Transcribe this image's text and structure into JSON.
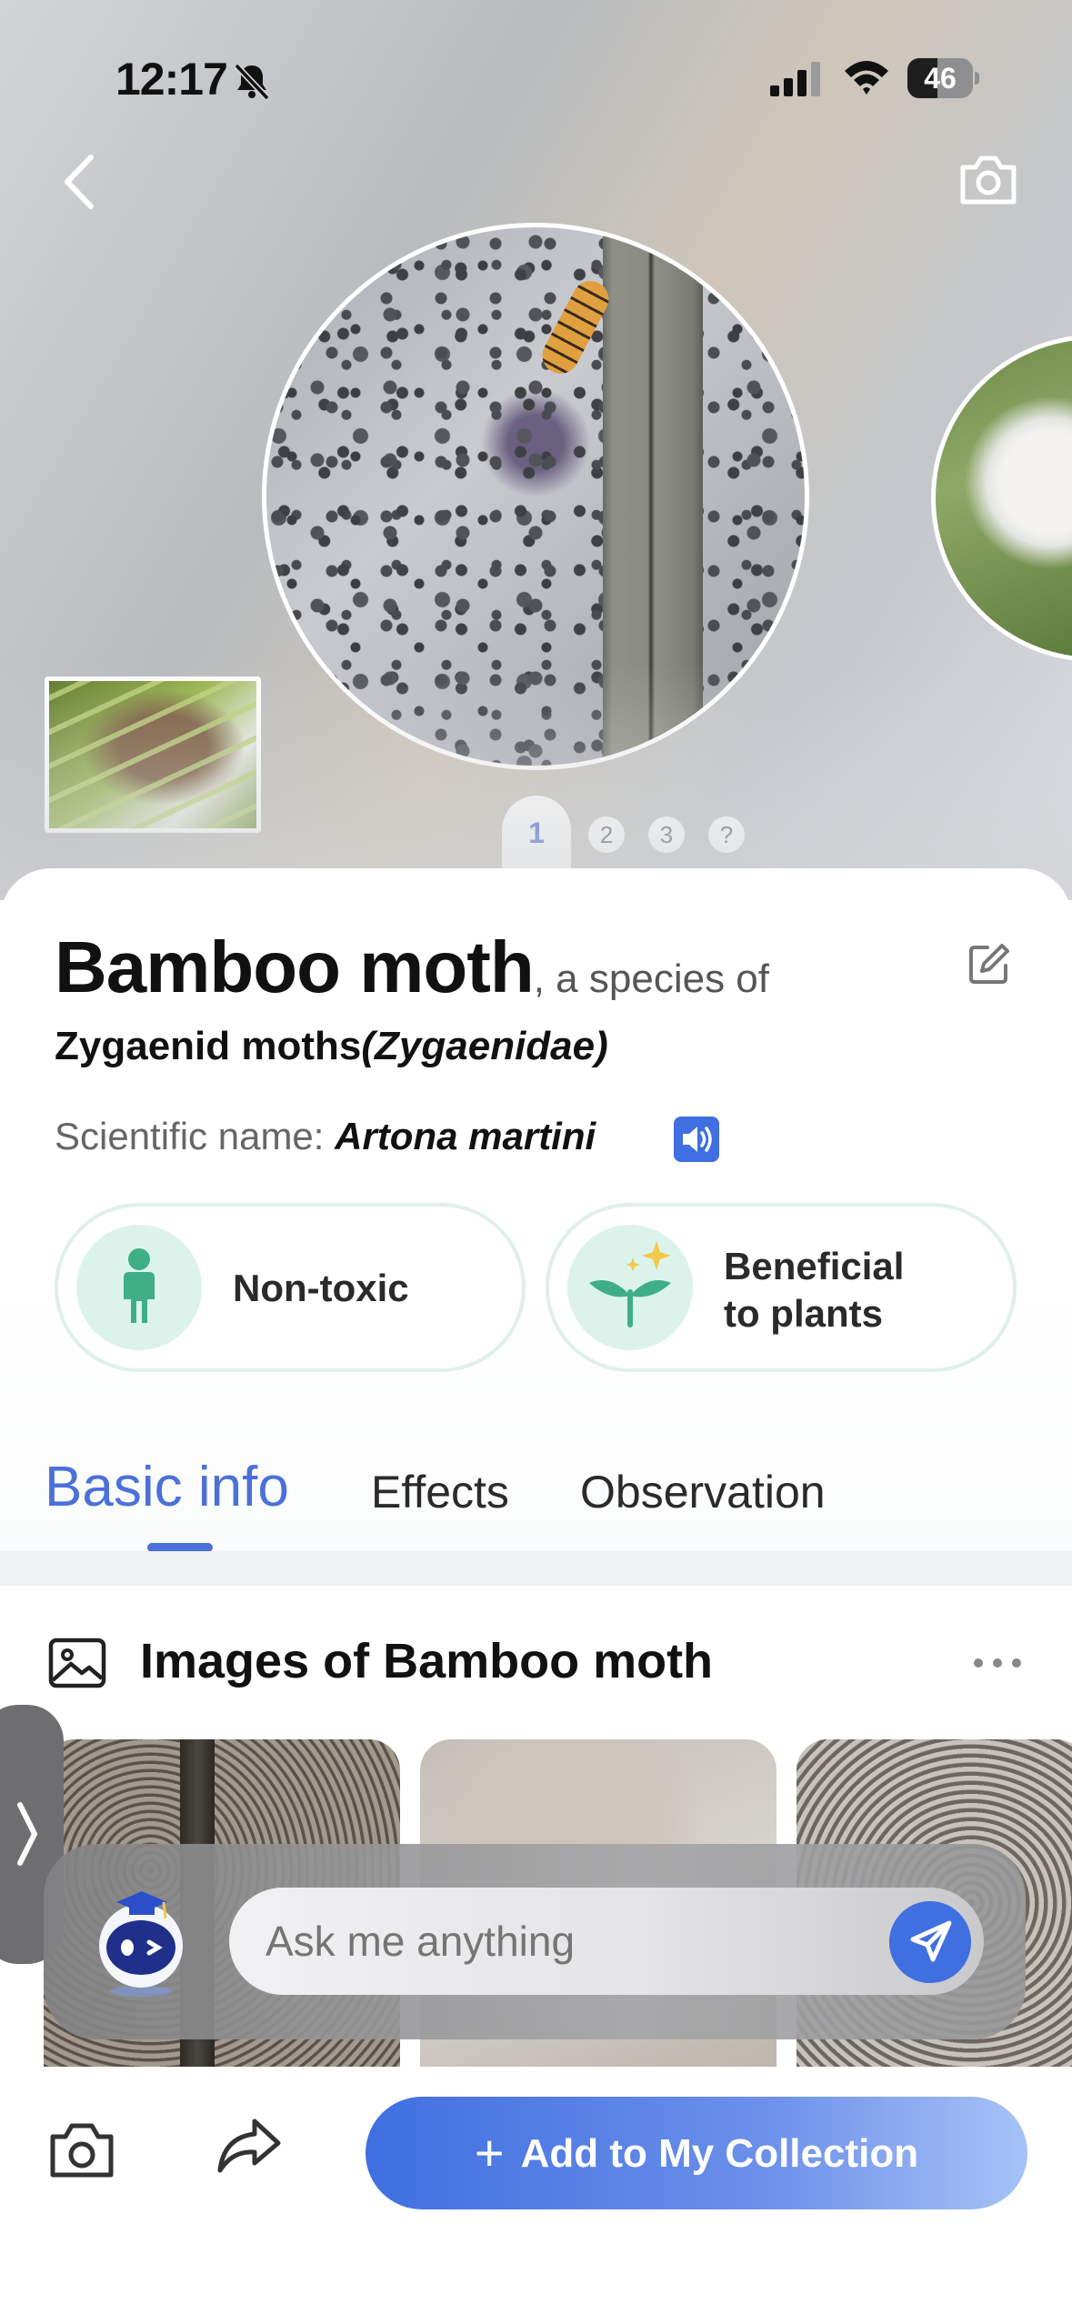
{
  "status_bar": {
    "time": "12:17",
    "battery_percent": 46,
    "battery_text": "46"
  },
  "hero": {
    "pager": {
      "active": "1",
      "dots": [
        "2",
        "3",
        "?"
      ]
    }
  },
  "species": {
    "common_name": "Bamboo moth",
    "species_of_text": ", a species of",
    "family_common": "Zygaenid moths",
    "family_latin": "(Zygaenidae)",
    "scientific_label": "Scientific name: ",
    "scientific_name": "Artona martini"
  },
  "tags": [
    {
      "label": "Non-toxic",
      "icon": "person-icon"
    },
    {
      "label_line1": "Beneficial",
      "label_line2": "to plants",
      "icon": "sprout-sparkle-icon"
    }
  ],
  "tabs": {
    "basic": "Basic info",
    "effects": "Effects",
    "observation": "Observation"
  },
  "images_section": {
    "title": "Images of Bamboo moth"
  },
  "assistant": {
    "placeholder": "Ask me anything"
  },
  "bottom": {
    "collect_label": "Add to My Collection"
  },
  "colors": {
    "accent": "#4c70d9",
    "send": "#3f6fe0",
    "tag_bg": "#dcf3eb",
    "tag_icon": "#3fae86"
  }
}
